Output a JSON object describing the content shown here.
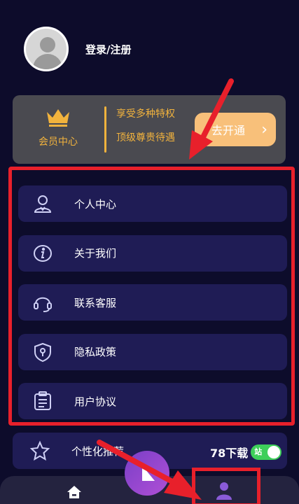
{
  "profile": {
    "login_label": "登录/注册"
  },
  "vip": {
    "title": "会员中心",
    "line1": "享受多种特权",
    "line2": "顶级尊贵待遇",
    "button_label": "去开通",
    "accent": "#f2b33d"
  },
  "menu": {
    "items": [
      {
        "label": "个人中心",
        "icon": "person-icon"
      },
      {
        "label": "关于我们",
        "icon": "info-icon"
      },
      {
        "label": "联系客服",
        "icon": "headset-icon"
      },
      {
        "label": "隐私政策",
        "icon": "shield-icon"
      },
      {
        "label": "用户协议",
        "icon": "clipboard-icon"
      }
    ]
  },
  "extra_item": {
    "label": "个性化推荐",
    "icon": "star-icon"
  },
  "watermark": {
    "text": "78下载",
    "badge": "站"
  },
  "annotation": {
    "color": "#e8202b"
  }
}
